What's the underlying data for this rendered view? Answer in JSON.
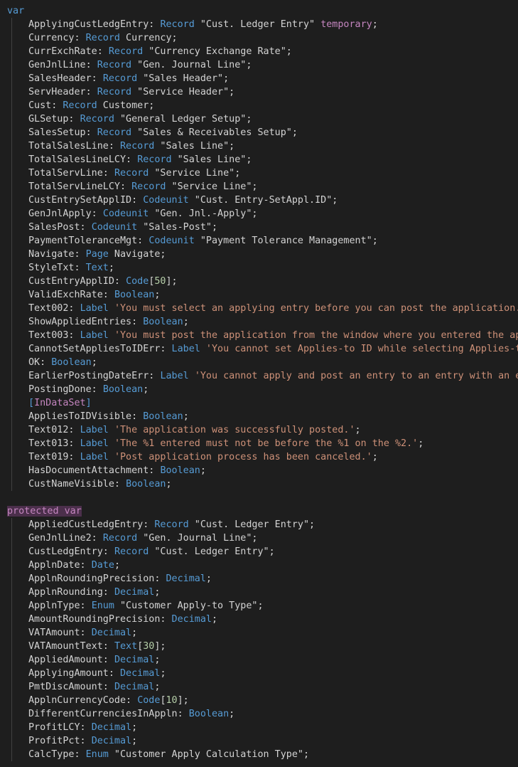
{
  "editor": {
    "blocks": [
      {
        "keyword": "var",
        "highlighted": false,
        "lines": [
          [
            {
              "t": "ApplyingCustLedgEntry: ",
              "c": ""
            },
            {
              "t": "Record",
              "c": "ty"
            },
            {
              "t": " ",
              "c": ""
            },
            {
              "t": "\"Cust. Ledger Entry\"",
              "c": ""
            },
            {
              "t": " ",
              "c": ""
            },
            {
              "t": "temporary",
              "c": "tmp"
            },
            {
              "t": ";",
              "c": ""
            }
          ],
          [
            {
              "t": "Currency: ",
              "c": ""
            },
            {
              "t": "Record",
              "c": "ty"
            },
            {
              "t": " Currency;",
              "c": ""
            }
          ],
          [
            {
              "t": "CurrExchRate: ",
              "c": ""
            },
            {
              "t": "Record",
              "c": "ty"
            },
            {
              "t": " \"Currency Exchange Rate\";",
              "c": ""
            }
          ],
          [
            {
              "t": "GenJnlLine: ",
              "c": ""
            },
            {
              "t": "Record",
              "c": "ty"
            },
            {
              "t": " \"Gen. Journal Line\";",
              "c": ""
            }
          ],
          [
            {
              "t": "SalesHeader: ",
              "c": ""
            },
            {
              "t": "Record",
              "c": "ty"
            },
            {
              "t": " \"Sales Header\";",
              "c": ""
            }
          ],
          [
            {
              "t": "ServHeader: ",
              "c": ""
            },
            {
              "t": "Record",
              "c": "ty"
            },
            {
              "t": " \"Service Header\";",
              "c": ""
            }
          ],
          [
            {
              "t": "Cust: ",
              "c": ""
            },
            {
              "t": "Record",
              "c": "ty"
            },
            {
              "t": " Customer;",
              "c": ""
            }
          ],
          [
            {
              "t": "GLSetup: ",
              "c": ""
            },
            {
              "t": "Record",
              "c": "ty"
            },
            {
              "t": " \"General Ledger Setup\";",
              "c": ""
            }
          ],
          [
            {
              "t": "SalesSetup: ",
              "c": ""
            },
            {
              "t": "Record",
              "c": "ty"
            },
            {
              "t": " \"Sales & Receivables Setup\";",
              "c": ""
            }
          ],
          [
            {
              "t": "TotalSalesLine: ",
              "c": ""
            },
            {
              "t": "Record",
              "c": "ty"
            },
            {
              "t": " \"Sales Line\";",
              "c": ""
            }
          ],
          [
            {
              "t": "TotalSalesLineLCY: ",
              "c": ""
            },
            {
              "t": "Record",
              "c": "ty"
            },
            {
              "t": " \"Sales Line\";",
              "c": ""
            }
          ],
          [
            {
              "t": "TotalServLine: ",
              "c": ""
            },
            {
              "t": "Record",
              "c": "ty"
            },
            {
              "t": " \"Service Line\";",
              "c": ""
            }
          ],
          [
            {
              "t": "TotalServLineLCY: ",
              "c": ""
            },
            {
              "t": "Record",
              "c": "ty"
            },
            {
              "t": " \"Service Line\";",
              "c": ""
            }
          ],
          [
            {
              "t": "CustEntrySetApplID: ",
              "c": ""
            },
            {
              "t": "Codeunit",
              "c": "ty"
            },
            {
              "t": " \"Cust. Entry-SetAppl.ID\";",
              "c": ""
            }
          ],
          [
            {
              "t": "GenJnlApply: ",
              "c": ""
            },
            {
              "t": "Codeunit",
              "c": "ty"
            },
            {
              "t": " \"Gen. Jnl.-Apply\";",
              "c": ""
            }
          ],
          [
            {
              "t": "SalesPost: ",
              "c": ""
            },
            {
              "t": "Codeunit",
              "c": "ty"
            },
            {
              "t": " \"Sales-Post\";",
              "c": ""
            }
          ],
          [
            {
              "t": "PaymentToleranceMgt: ",
              "c": ""
            },
            {
              "t": "Codeunit",
              "c": "ty"
            },
            {
              "t": " \"Payment Tolerance Management\";",
              "c": ""
            }
          ],
          [
            {
              "t": "Navigate: ",
              "c": ""
            },
            {
              "t": "Page",
              "c": "ty"
            },
            {
              "t": " Navigate;",
              "c": ""
            }
          ],
          [
            {
              "t": "StyleTxt: ",
              "c": ""
            },
            {
              "t": "Text",
              "c": "ty"
            },
            {
              "t": ";",
              "c": ""
            }
          ],
          [
            {
              "t": "CustEntryApplID: ",
              "c": ""
            },
            {
              "t": "Code",
              "c": "ty"
            },
            {
              "t": "[",
              "c": ""
            },
            {
              "t": "50",
              "c": "num"
            },
            {
              "t": "];",
              "c": ""
            }
          ],
          [
            {
              "t": "ValidExchRate: ",
              "c": ""
            },
            {
              "t": "Boolean",
              "c": "ty"
            },
            {
              "t": ";",
              "c": ""
            }
          ],
          [
            {
              "t": "Text002: ",
              "c": ""
            },
            {
              "t": "Label",
              "c": "ty"
            },
            {
              "t": " ",
              "c": ""
            },
            {
              "t": "'You must select an applying entry before you can post the application.'",
              "c": "str"
            },
            {
              "t": ";",
              "c": ""
            }
          ],
          [
            {
              "t": "ShowAppliedEntries: ",
              "c": ""
            },
            {
              "t": "Boolean",
              "c": "ty"
            },
            {
              "t": ";",
              "c": ""
            }
          ],
          [
            {
              "t": "Text003: ",
              "c": ""
            },
            {
              "t": "Label",
              "c": "ty"
            },
            {
              "t": " ",
              "c": ""
            },
            {
              "t": "'You must post the application from the window where you entered the applying entry.'",
              "c": "str"
            }
          ],
          [
            {
              "t": "CannotSetAppliesToIDErr: ",
              "c": ""
            },
            {
              "t": "Label",
              "c": "ty"
            },
            {
              "t": " ",
              "c": ""
            },
            {
              "t": "'You cannot set Applies-to ID while selecting Applies-to Doc. No.'",
              "c": "str"
            }
          ],
          [
            {
              "t": "OK: ",
              "c": ""
            },
            {
              "t": "Boolean",
              "c": "ty"
            },
            {
              "t": ";",
              "c": ""
            }
          ],
          [
            {
              "t": "EarlierPostingDateErr: ",
              "c": ""
            },
            {
              "t": "Label",
              "c": "ty"
            },
            {
              "t": " ",
              "c": ""
            },
            {
              "t": "'You cannot apply and post an entry to an entry with an earlier posting date.'",
              "c": "str"
            }
          ],
          [
            {
              "t": "PostingDone: ",
              "c": ""
            },
            {
              "t": "Boolean",
              "c": "ty"
            },
            {
              "t": ";",
              "c": ""
            }
          ],
          [
            {
              "t": "[",
              "c": "br"
            },
            {
              "t": "InDataSet",
              "c": "attr"
            },
            {
              "t": "]",
              "c": "br"
            }
          ],
          [
            {
              "t": "AppliesToIDVisible: ",
              "c": ""
            },
            {
              "t": "Boolean",
              "c": "ty"
            },
            {
              "t": ";",
              "c": ""
            }
          ],
          [
            {
              "t": "Text012: ",
              "c": ""
            },
            {
              "t": "Label",
              "c": "ty"
            },
            {
              "t": " ",
              "c": ""
            },
            {
              "t": "'The application was successfully posted.'",
              "c": "str"
            },
            {
              "t": ";",
              "c": ""
            }
          ],
          [
            {
              "t": "Text013: ",
              "c": ""
            },
            {
              "t": "Label",
              "c": "ty"
            },
            {
              "t": " ",
              "c": ""
            },
            {
              "t": "'The %1 entered must not be before the %1 on the %2.'",
              "c": "str"
            },
            {
              "t": ";",
              "c": ""
            }
          ],
          [
            {
              "t": "Text019: ",
              "c": ""
            },
            {
              "t": "Label",
              "c": "ty"
            },
            {
              "t": " ",
              "c": ""
            },
            {
              "t": "'Post application process has been canceled.'",
              "c": "str"
            },
            {
              "t": ";",
              "c": ""
            }
          ],
          [
            {
              "t": "HasDocumentAttachment: ",
              "c": ""
            },
            {
              "t": "Boolean",
              "c": "ty"
            },
            {
              "t": ";",
              "c": ""
            }
          ],
          [
            {
              "t": "CustNameVisible: ",
              "c": ""
            },
            {
              "t": "Boolean",
              "c": "ty"
            },
            {
              "t": ";",
              "c": ""
            }
          ]
        ]
      },
      {
        "keyword": "protected var",
        "highlighted": true,
        "lines": [
          [
            {
              "t": "AppliedCustLedgEntry: ",
              "c": ""
            },
            {
              "t": "Record",
              "c": "ty"
            },
            {
              "t": " \"Cust. Ledger Entry\";",
              "c": ""
            }
          ],
          [
            {
              "t": "GenJnlLine2: ",
              "c": ""
            },
            {
              "t": "Record",
              "c": "ty"
            },
            {
              "t": " \"Gen. Journal Line\";",
              "c": ""
            }
          ],
          [
            {
              "t": "CustLedgEntry: ",
              "c": ""
            },
            {
              "t": "Record",
              "c": "ty"
            },
            {
              "t": " \"Cust. Ledger Entry\";",
              "c": ""
            }
          ],
          [
            {
              "t": "ApplnDate: ",
              "c": ""
            },
            {
              "t": "Date",
              "c": "ty"
            },
            {
              "t": ";",
              "c": ""
            }
          ],
          [
            {
              "t": "ApplnRoundingPrecision: ",
              "c": ""
            },
            {
              "t": "Decimal",
              "c": "ty"
            },
            {
              "t": ";",
              "c": ""
            }
          ],
          [
            {
              "t": "ApplnRounding: ",
              "c": ""
            },
            {
              "t": "Decimal",
              "c": "ty"
            },
            {
              "t": ";",
              "c": ""
            }
          ],
          [
            {
              "t": "ApplnType: ",
              "c": ""
            },
            {
              "t": "Enum",
              "c": "ty"
            },
            {
              "t": " \"Customer Apply-to Type\";",
              "c": ""
            }
          ],
          [
            {
              "t": "AmountRoundingPrecision: ",
              "c": ""
            },
            {
              "t": "Decimal",
              "c": "ty"
            },
            {
              "t": ";",
              "c": ""
            }
          ],
          [
            {
              "t": "VATAmount: ",
              "c": ""
            },
            {
              "t": "Decimal",
              "c": "ty"
            },
            {
              "t": ";",
              "c": ""
            }
          ],
          [
            {
              "t": "VATAmountText: ",
              "c": ""
            },
            {
              "t": "Text",
              "c": "ty"
            },
            {
              "t": "[",
              "c": ""
            },
            {
              "t": "30",
              "c": "num"
            },
            {
              "t": "];",
              "c": ""
            }
          ],
          [
            {
              "t": "AppliedAmount: ",
              "c": ""
            },
            {
              "t": "Decimal",
              "c": "ty"
            },
            {
              "t": ";",
              "c": ""
            }
          ],
          [
            {
              "t": "ApplyingAmount: ",
              "c": ""
            },
            {
              "t": "Decimal",
              "c": "ty"
            },
            {
              "t": ";",
              "c": ""
            }
          ],
          [
            {
              "t": "PmtDiscAmount: ",
              "c": ""
            },
            {
              "t": "Decimal",
              "c": "ty"
            },
            {
              "t": ";",
              "c": ""
            }
          ],
          [
            {
              "t": "ApplnCurrencyCode: ",
              "c": ""
            },
            {
              "t": "Code",
              "c": "ty"
            },
            {
              "t": "[",
              "c": ""
            },
            {
              "t": "10",
              "c": "num"
            },
            {
              "t": "];",
              "c": ""
            }
          ],
          [
            {
              "t": "DifferentCurrenciesInAppln: ",
              "c": ""
            },
            {
              "t": "Boolean",
              "c": "ty"
            },
            {
              "t": ";",
              "c": ""
            }
          ],
          [
            {
              "t": "ProfitLCY: ",
              "c": ""
            },
            {
              "t": "Decimal",
              "c": "ty"
            },
            {
              "t": ";",
              "c": ""
            }
          ],
          [
            {
              "t": "ProfitPct: ",
              "c": ""
            },
            {
              "t": "Decimal",
              "c": "ty"
            },
            {
              "t": ";",
              "c": ""
            }
          ],
          [
            {
              "t": "CalcType: ",
              "c": ""
            },
            {
              "t": "Enum",
              "c": "ty"
            },
            {
              "t": " \"Customer Apply Calculation Type\";",
              "c": ""
            }
          ]
        ]
      }
    ]
  }
}
